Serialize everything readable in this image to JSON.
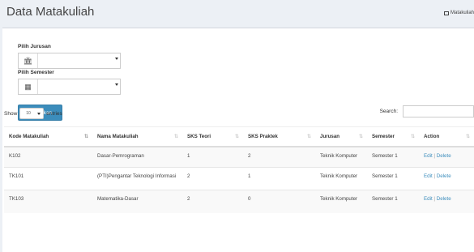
{
  "header": {
    "title": "Data Matakuliah",
    "breadcrumb": "Matakuliah"
  },
  "form": {
    "jurusan_label": "Pilih Jurusan",
    "jurusan_icon": "bank-icon",
    "jurusan_value": "",
    "semester_label": "Pilih Semester",
    "semester_icon": "calendar-icon",
    "semester_value": "",
    "submit_label": "Tampilkan"
  },
  "table_controls": {
    "show_label": "Show",
    "length_value": "10",
    "entries_label": "entries",
    "search_label": "Search:"
  },
  "table": {
    "columns": [
      "Kode Matakuliah",
      "Nama Matakuliah",
      "SKS Teori",
      "SKS Praktek",
      "Jurusan",
      "Semester",
      "Action"
    ],
    "rows": [
      {
        "kode": "K102",
        "nama": "Dasar-Pemrograman",
        "sks_teori": "1",
        "sks_praktek": "2",
        "jurusan": "Teknik Komputer",
        "semester": "Semester 1",
        "edit": "Edit",
        "sep": "|",
        "delete": "Delete"
      },
      {
        "kode": "TK101",
        "nama": "(PTI)Pengantar Teknologi Informasi",
        "sks_teori": "2",
        "sks_praktek": "1",
        "jurusan": "Teknik Komputer",
        "semester": "Semester 1",
        "edit": "Edit",
        "sep": "|",
        "delete": "Delete"
      },
      {
        "kode": "TK103",
        "nama": "Matematika-Dasar",
        "sks_teori": "2",
        "sks_praktek": "0",
        "jurusan": "Teknik Komputer",
        "semester": "Semester 1",
        "edit": "Edit",
        "sep": "|",
        "delete": "Delete"
      }
    ]
  },
  "colors": {
    "primary": "#3c8dbc",
    "background": "#ecf0f5"
  }
}
